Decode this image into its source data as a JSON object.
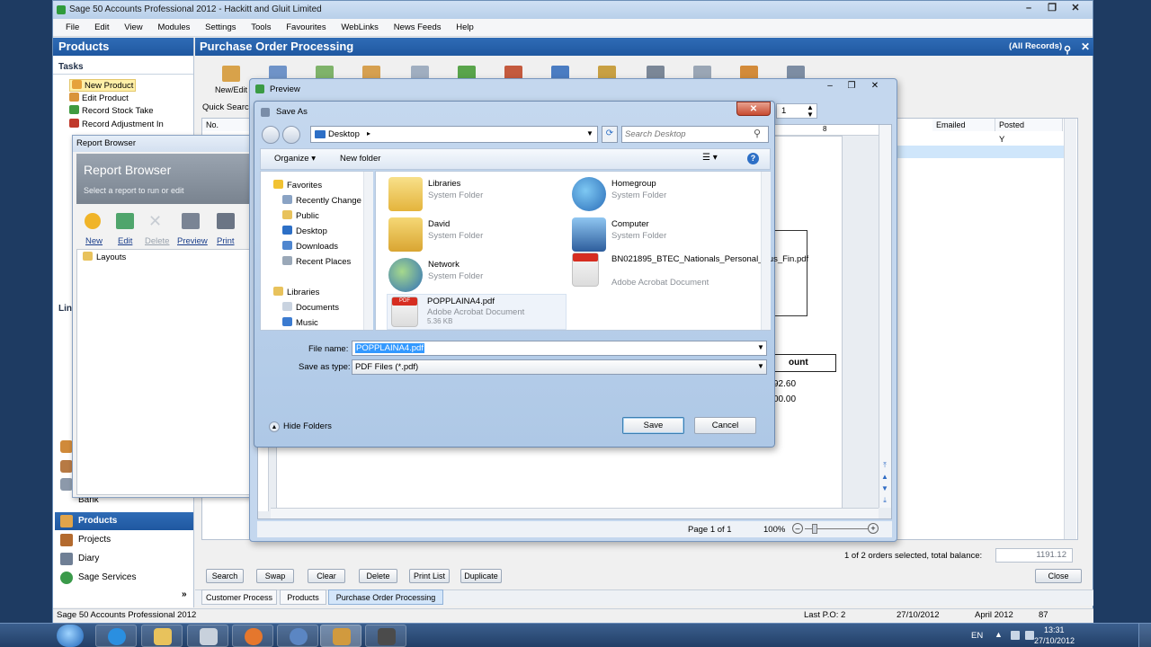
{
  "app": {
    "title": "Sage 50 Accounts Professional 2012 - Hackitt and Gluit Limited",
    "menu": [
      "File",
      "Edit",
      "View",
      "Modules",
      "Settings",
      "Tools",
      "Favourites",
      "WebLinks",
      "News Feeds",
      "Help"
    ],
    "window_buttons": [
      "–",
      "❐",
      "✕"
    ]
  },
  "left_pane": {
    "header": "Products",
    "tasks_label": "Tasks",
    "tasks": [
      "New Product",
      "Edit Product",
      "Record Stock Take",
      "Record Adjustment In"
    ],
    "partial_label": "Lin",
    "nav_items": [
      "Bank",
      "Products",
      "Projects",
      "Diary",
      "Sage Services"
    ],
    "collapse_glyph": "»"
  },
  "main": {
    "header": "Purchase Order Processing",
    "records_label": "(All Records)",
    "toolbar": [
      "New/Edit"
    ],
    "quick_search_label": "Quick Search",
    "columns": [
      "No.",
      "Emailed",
      "Posted"
    ],
    "row_values": [
      "Y"
    ],
    "status_text": "1 of 2 orders selected, total balance:",
    "total_balance": "1191.12",
    "buttons": [
      "Search",
      "Swap",
      "Clear",
      "Delete",
      "Print List",
      "Duplicate"
    ],
    "close_button": "Close",
    "tabs": [
      "Customer Process",
      "Products",
      "Purchase Order Processing"
    ]
  },
  "report_browser": {
    "window_title": "Report Browser",
    "heading": "Report Browser",
    "subheading": "Select a report to run or edit",
    "tools": [
      "New",
      "Edit",
      "Delete",
      "Preview",
      "Print"
    ],
    "tree": [
      "Layouts"
    ]
  },
  "preview": {
    "window_title": "Preview",
    "page_number": "1",
    "ruler_mark": "8",
    "amount_header": "ount",
    "amounts": [
      "92.60",
      "00.00"
    ],
    "page_label": "Page 1 of 1",
    "zoom": "100%",
    "ruler_left": "6"
  },
  "save_as": {
    "title": "Save As",
    "location": "Desktop",
    "search_placeholder": "Search Desktop",
    "organize": "Organize",
    "new_folder": "New folder",
    "nav_tree": [
      {
        "label": "Favorites",
        "type": "group"
      },
      {
        "label": "Recently Change",
        "type": "item"
      },
      {
        "label": "Public",
        "type": "item"
      },
      {
        "label": "Desktop",
        "type": "item"
      },
      {
        "label": "Downloads",
        "type": "item"
      },
      {
        "label": "Recent Places",
        "type": "item"
      },
      {
        "label": "Libraries",
        "type": "group"
      },
      {
        "label": "Documents",
        "type": "item"
      },
      {
        "label": "Music",
        "type": "item"
      }
    ],
    "files": [
      {
        "name": "Libraries",
        "type": "System Folder",
        "icon": "libraries-icon"
      },
      {
        "name": "Homegroup",
        "type": "System Folder",
        "icon": "homegroup-icon"
      },
      {
        "name": "David",
        "type": "System Folder",
        "icon": "user-folder-icon"
      },
      {
        "name": "Computer",
        "type": "System Folder",
        "icon": "computer-icon"
      },
      {
        "name": "Network",
        "type": "System Folder",
        "icon": "network-icon"
      },
      {
        "name": "BN021895_BTEC_Nationals_Personal_Bus_Fin.pdf",
        "type": "Adobe Acrobat Document",
        "icon": "pdf-icon"
      },
      {
        "name": "POPPLAINA4.pdf",
        "type": "Adobe Acrobat Document",
        "size": "5.36 KB",
        "icon": "pdf-icon"
      }
    ],
    "file_name_label": "File name:",
    "file_name_value": "POPPLAINA4.pdf",
    "save_as_type_label": "Save as type:",
    "save_as_type_value": "PDF Files (*.pdf)",
    "hide_folders": "Hide Folders",
    "save_button": "Save",
    "cancel_button": "Cancel",
    "close_glyph": "✕"
  },
  "status_bar": {
    "app": "Sage 50 Accounts Professional 2012",
    "last_po": "Last P.O: 2",
    "date": "27/10/2012",
    "period": "April 2012",
    "number": "87"
  },
  "taskbar": {
    "language": "EN",
    "time": "13:31",
    "date": "27/10/2012"
  },
  "colors": {
    "sage_blue": "#2463ad",
    "selection": "#3399ff",
    "row_highlight": "#cfe6fb",
    "taskbar": "#2a4a78"
  }
}
